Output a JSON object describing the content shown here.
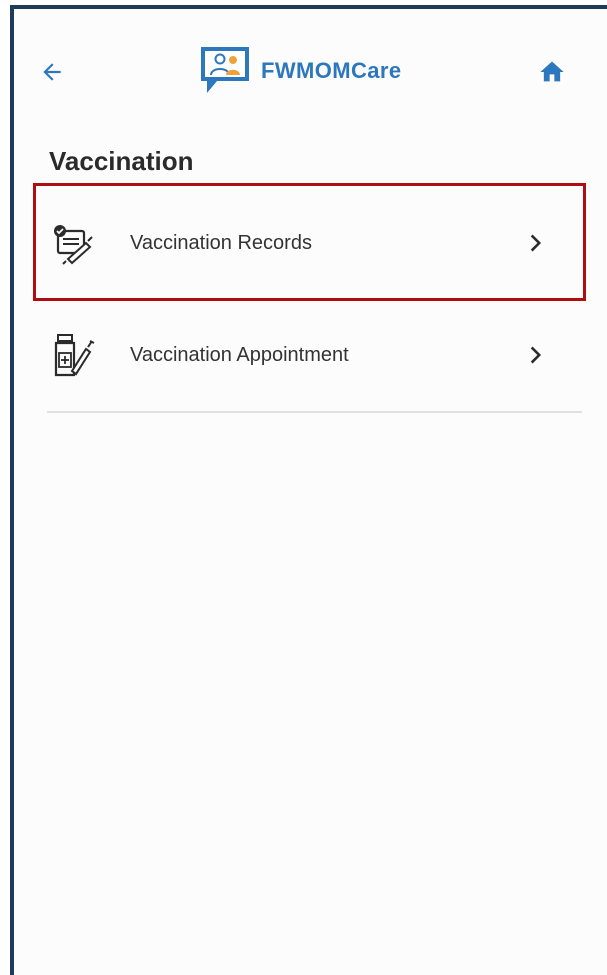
{
  "header": {
    "back_icon": "arrow-left-icon",
    "brand_name": "FWMOMCare",
    "brand_logo_icon": "chat-bubble-family-logo",
    "home_icon": "home-icon"
  },
  "page": {
    "title": "Vaccination"
  },
  "menu": {
    "items": [
      {
        "label": "Vaccination Records",
        "icon": "vaccination-record-clipboard-icon",
        "chevron": "chevron-right-icon",
        "highlighted": true
      },
      {
        "label": "Vaccination Appointment",
        "icon": "vaccine-vial-syringe-icon",
        "chevron": "chevron-right-icon",
        "highlighted": false
      }
    ]
  },
  "colors": {
    "brand": "#2d78bd",
    "highlight_border": "#b00d10",
    "frame_border": "#1f3b5a",
    "text_primary": "#2b2b2b",
    "text_item": "#333333",
    "divider": "#e0e0e0"
  }
}
